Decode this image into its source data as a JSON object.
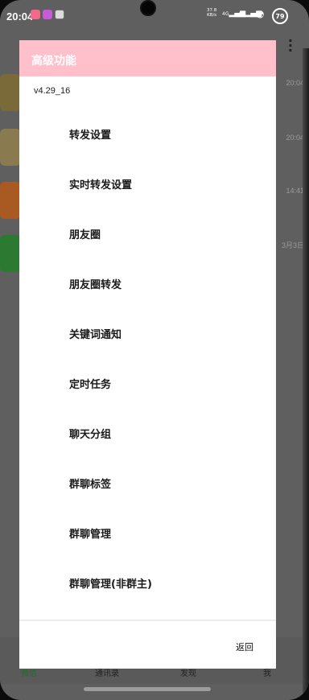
{
  "status_bar": {
    "time": "20:04",
    "net_speed_value": "37.8",
    "net_speed_unit": "KB/s",
    "signal_1": "4G",
    "signal_2": "4G",
    "battery": "79"
  },
  "background": {
    "list_times": [
      "20:04",
      "20:04",
      "14:41",
      "3月3日"
    ],
    "nav": [
      "微信",
      "通讯录",
      "发现",
      "我"
    ]
  },
  "dialog": {
    "title": "高级功能",
    "version": "v4.29_16",
    "items": [
      "转发设置",
      "实时转发设置",
      "朋友圈",
      "朋友圈转发",
      "关键词通知",
      "定时任务",
      "聊天分组",
      "群聊标签",
      "群聊管理",
      "群聊管理(非群主)"
    ],
    "back_label": "返回"
  },
  "colors": {
    "header": "#ffc0cb",
    "overlay": "#5f5f5f"
  }
}
